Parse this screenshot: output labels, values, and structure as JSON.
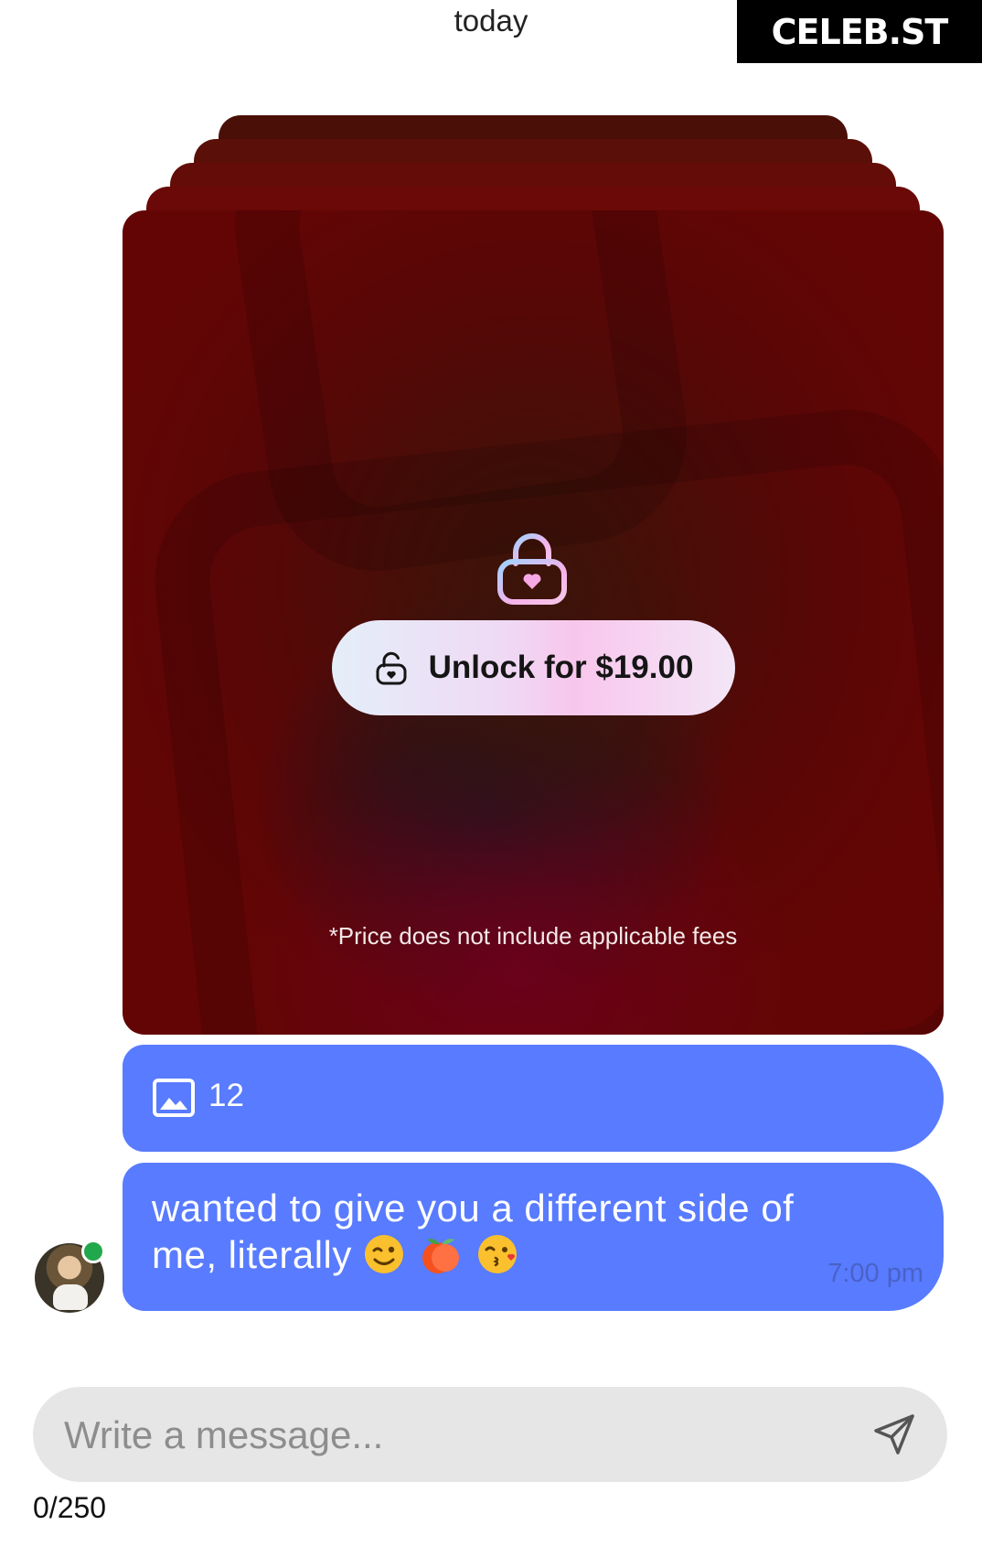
{
  "header": {
    "date_divider": "today",
    "watermark": "CELEB.ST"
  },
  "locked_message": {
    "lock_icon": "lock-heart-icon",
    "unlock_button_label": "Unlock for $19.00",
    "unlock_icon": "unlock-icon",
    "fees_note": "*Price does not include applicable fees",
    "card_color": "#630505"
  },
  "media_attachment": {
    "icon": "image-icon",
    "count": "12"
  },
  "message": {
    "text": "wanted to give you a different side of me, literally",
    "emojis": [
      "wink-emoji",
      "peach-emoji",
      "kiss-emoji"
    ],
    "time": "7:00 pm",
    "bubble_color": "#587bff"
  },
  "sender": {
    "avatar": "avatar",
    "online": true,
    "online_color": "#22a84c"
  },
  "composer": {
    "placeholder": "Write a message...",
    "value": "",
    "send_icon": "send-icon",
    "char_count": "0/250"
  }
}
